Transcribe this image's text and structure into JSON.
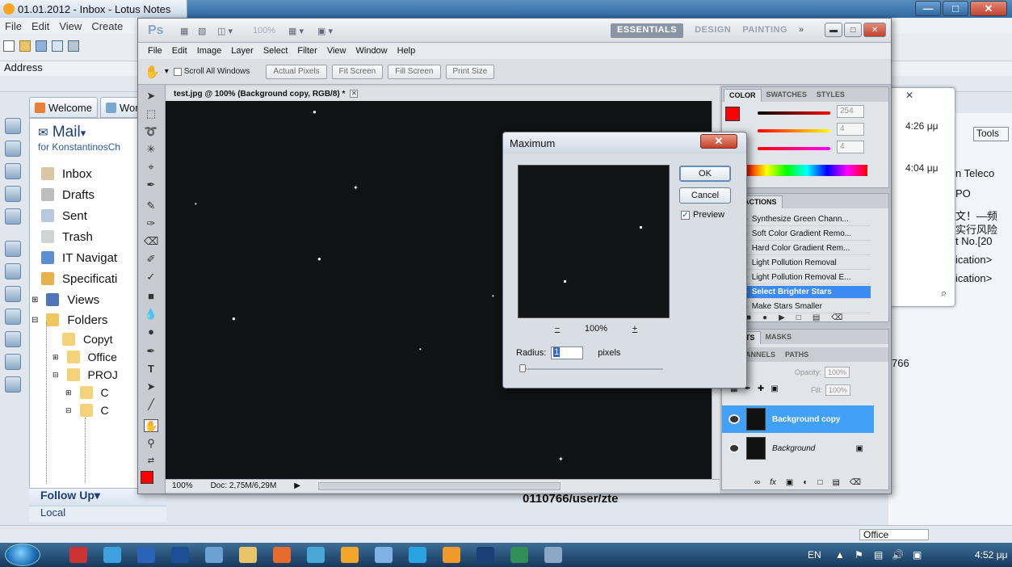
{
  "lotus": {
    "title": "01.01.2012 - Inbox - Lotus Notes",
    "menu": [
      "File",
      "Edit",
      "View",
      "Create"
    ],
    "address_label": "Address",
    "tabs": [
      {
        "label": "Welcome"
      },
      {
        "label": "Wor"
      }
    ],
    "mail_title": "Mail",
    "mail_dropdown": "▾",
    "mail_subtitle": "for KonstantinosCh",
    "nav_items": [
      {
        "label": "Inbox"
      },
      {
        "label": "Drafts"
      },
      {
        "label": "Sent"
      },
      {
        "label": "Trash"
      },
      {
        "label": "IT Navigat"
      },
      {
        "label": "Specificati"
      },
      {
        "label": "Views"
      },
      {
        "label": "Folders"
      }
    ],
    "folder_items": [
      "Copyt",
      "Office",
      "PROJ",
      "C",
      "C"
    ],
    "follow_up": "Follow Up",
    "follow_up_arrow": "▾",
    "local": "Local",
    "right_pane": {
      "times": [
        "4:26 μμ",
        "4:04 μμ"
      ],
      "tools": "Tools",
      "rows": [
        "n Teleco",
        "PO",
        "文！—频",
        "实行风险",
        "t No.[20",
        "ication>",
        "ication>",
        "766"
      ]
    },
    "path_text": "0110766/user/zte",
    "status_office": "Office"
  },
  "photoshop": {
    "logo": "Ps",
    "zoom_label": "100%",
    "workspaces": {
      "essentials": "ESSENTIALS",
      "design": "DESIGN",
      "painting": "PAINTING",
      "more": "»"
    },
    "menu": [
      "File",
      "Edit",
      "Image",
      "Layer",
      "Select",
      "Filter",
      "View",
      "Window",
      "Help"
    ],
    "options": {
      "scroll_all": "Scroll All Windows",
      "actual_pixels": "Actual Pixels",
      "fit_screen": "Fit Screen",
      "fill_screen": "Fill Screen",
      "print_size": "Print Size"
    },
    "document_tab": "test.jpg @ 100% (Background copy, RGB/8) *",
    "status": {
      "zoom": "100%",
      "doc": "Doc: 2,75M/6,29M"
    },
    "color_panel": {
      "tabs": [
        "COLOR",
        "SWATCHES",
        "STYLES"
      ],
      "values": [
        "254",
        "4",
        "4"
      ],
      "fg_color": "#ff0000"
    },
    "actions_panel": {
      "tabs": [
        "Y",
        "ACTIONS"
      ],
      "items": [
        {
          "label": "Synthesize Green Chann...",
          "selected": false
        },
        {
          "label": "Soft Color Gradient Remo...",
          "selected": false
        },
        {
          "label": "Hard Color Gradient Rem...",
          "selected": false
        },
        {
          "label": "Light Pollution Removal",
          "selected": false
        },
        {
          "label": "Light Pollution Removal E...",
          "selected": false
        },
        {
          "label": "Select Brighter Stars",
          "selected": true
        },
        {
          "label": "Make Stars Smaller",
          "selected": false
        }
      ]
    },
    "layers_panel": {
      "tabs_top": [
        "MENTS",
        "MASKS"
      ],
      "tabs": [
        "CHANNELS",
        "PATHS"
      ],
      "opacity_label": "Opacity:",
      "opacity": "100%",
      "fill_label": "Fill:",
      "fill": "100%",
      "layers": [
        {
          "name": "Background copy",
          "selected": true
        },
        {
          "name": "Background",
          "selected": false
        }
      ]
    }
  },
  "dialog": {
    "title": "Maximum",
    "ok": "OK",
    "cancel": "Cancel",
    "preview_label": "Preview",
    "preview_checked": true,
    "zoom": "100%",
    "zoom_out": "−",
    "zoom_in": "+",
    "radius_label": "Radius:",
    "radius_value": "1",
    "radius_unit": "pixels"
  },
  "taskbar": {
    "lang": "EN",
    "clock": "4:52 μμ"
  }
}
